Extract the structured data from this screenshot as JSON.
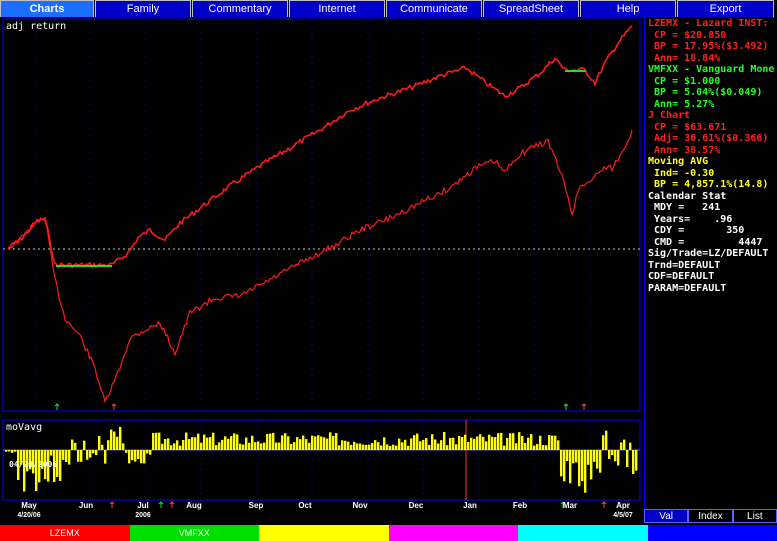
{
  "tabs": [
    {
      "label": "Charts",
      "active": true
    },
    {
      "label": "Family",
      "active": false
    },
    {
      "label": "Commentary",
      "active": false
    },
    {
      "label": "Internet",
      "active": false
    },
    {
      "label": "Communicate",
      "active": false
    },
    {
      "label": "SpreadSheet",
      "active": false
    },
    {
      "label": "Help",
      "active": false
    },
    {
      "label": "Export",
      "active": false
    }
  ],
  "upper_label": "adj return",
  "lower_label": "moVavg",
  "lower_date": "04/20/2006",
  "x_labels": [
    {
      "month": "May",
      "sub": "4/20/06"
    },
    {
      "month": "Jun",
      "sub": ""
    },
    {
      "month": "Jul",
      "sub": "2006"
    },
    {
      "month": "Aug",
      "sub": ""
    },
    {
      "month": "Sep",
      "sub": ""
    },
    {
      "month": "Oct",
      "sub": ""
    },
    {
      "month": "Nov",
      "sub": ""
    },
    {
      "month": "Dec",
      "sub": ""
    },
    {
      "month": "Jan",
      "sub": ""
    },
    {
      "month": "Feb",
      "sub": ""
    },
    {
      "month": "Mar",
      "sub": ""
    },
    {
      "month": "Apr",
      "sub": "4/5/07"
    }
  ],
  "panel": [
    {
      "text": "LZEMX - Lazard INST:",
      "color": "#ff2020"
    },
    {
      "text": " CP = $20.850",
      "color": "#ff2020"
    },
    {
      "text": " BP = 17.95%($3.492)",
      "color": "#ff2020"
    },
    {
      "text": " Ann= 18.84%",
      "color": "#ff2020"
    },
    {
      "text": "VMFXX - Vanguard Mone",
      "color": "#20ff20"
    },
    {
      "text": " CP = $1.000",
      "color": "#20ff20"
    },
    {
      "text": " BP = 5.04%($0.049)",
      "color": "#20ff20"
    },
    {
      "text": " Ann= 5.27%",
      "color": "#20ff20"
    },
    {
      "text": "J Chart",
      "color": "#ff2020"
    },
    {
      "text": " CP = $63.671",
      "color": "#ff2020"
    },
    {
      "text": " Adj= 36.61%($0.366)",
      "color": "#ff2020"
    },
    {
      "text": " Ann= 38.57%",
      "color": "#ff2020"
    },
    {
      "text": "Moving AVG",
      "color": "#ffff20"
    },
    {
      "text": " Ind= -0.30",
      "color": "#ffff20"
    },
    {
      "text": " BP = 4,857.1%(14.8)",
      "color": "#ffff20"
    },
    {
      "text": "Calendar Stat",
      "color": "#ffffff"
    },
    {
      "text": " MDY =   241",
      "color": "#ffffff"
    },
    {
      "text": " Years=    .96",
      "color": "#ffffff"
    },
    {
      "text": " CDY =       350",
      "color": "#ffffff"
    },
    {
      "text": " CMD =         4447",
      "color": "#ffffff"
    },
    {
      "text": "Sig/Trade=LZ/DEFAULT",
      "color": "#ffffff"
    },
    {
      "text": "Trnd=DEFAULT",
      "color": "#ffffff"
    },
    {
      "text": "CDF=DEFAULT",
      "color": "#ffffff"
    },
    {
      "text": "PARAM=DEFAULT",
      "color": "#ffffff"
    }
  ],
  "panel_tabs": [
    {
      "label": "Val",
      "active": true
    },
    {
      "label": "Index",
      "active": false
    },
    {
      "label": "List",
      "active": false
    }
  ],
  "bottom_bar": [
    {
      "label": "LZEMX",
      "color": "#ff0000"
    },
    {
      "label": "VMFXX",
      "color": "#00e000"
    },
    {
      "label": "",
      "color": "#ffff00"
    },
    {
      "label": "",
      "color": "#ff00ff"
    },
    {
      "label": "",
      "color": "#00ffff"
    },
    {
      "label": "",
      "color": "#0000ff"
    }
  ],
  "colors": {
    "grid": "#00008c",
    "frame": "#0000ff",
    "lzemx": "#ff1a1a",
    "vmfxx": "#20e020",
    "bars": "#ffff00",
    "baseline": "#c8c8c8"
  }
}
